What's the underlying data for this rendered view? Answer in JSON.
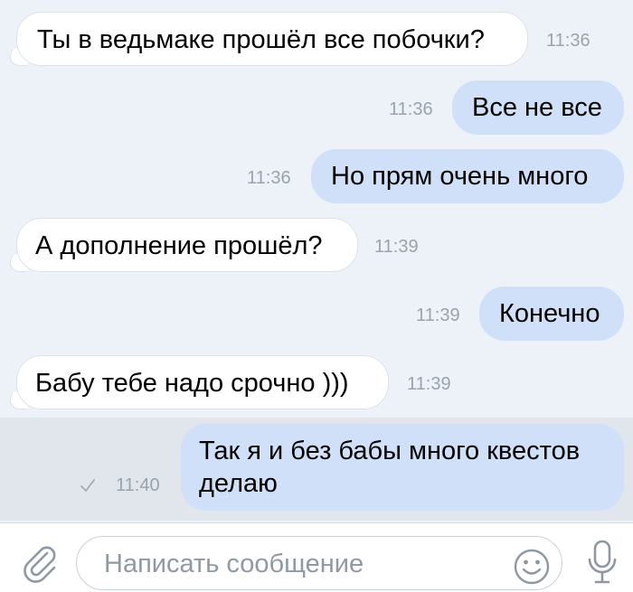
{
  "messages": [
    {
      "direction": "incoming",
      "text": "Ты в ведьмаке прошёл все побочки?",
      "time": "11:36"
    },
    {
      "direction": "outgoing",
      "text": "Все не все",
      "time": "11:36"
    },
    {
      "direction": "outgoing",
      "text": "Но прям очень много",
      "time": "11:36"
    },
    {
      "direction": "incoming",
      "text": "А дополнение прошёл?",
      "time": "11:39"
    },
    {
      "direction": "outgoing",
      "text": "Конечно",
      "time": "11:39"
    },
    {
      "direction": "incoming",
      "text": "Бабу тебе надо срочно )))",
      "time": "11:39"
    },
    {
      "direction": "outgoing",
      "text_line1": "Так я и без бабы много квестов",
      "text_line2": "делаю",
      "time": "11:40",
      "status_icon": "check-icon"
    }
  ],
  "composer": {
    "placeholder": "Написать сообщение",
    "icons": [
      "paperclip-icon",
      "smiley-icon",
      "microphone-icon"
    ]
  },
  "colors": {
    "background": "#edf2f9",
    "incoming_bubble": "#ffffff",
    "outgoing_bubble": "#cfe0f8",
    "timestamp": "#9aa3ad"
  }
}
